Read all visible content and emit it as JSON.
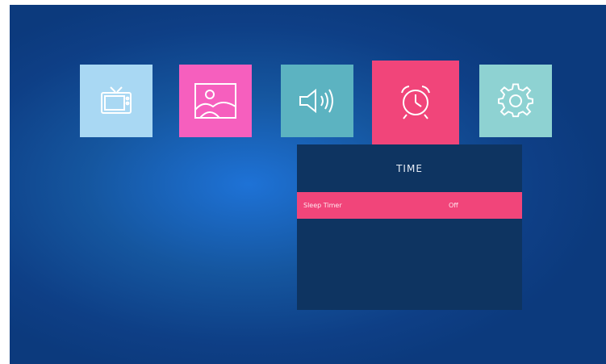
{
  "menu": {
    "tabs": [
      {
        "id": "tv",
        "icon": "tv-icon"
      },
      {
        "id": "picture",
        "icon": "picture-icon"
      },
      {
        "id": "sound",
        "icon": "speaker-icon"
      },
      {
        "id": "time",
        "icon": "alarm-clock-icon",
        "selected": true
      },
      {
        "id": "setup",
        "icon": "gear-icon"
      }
    ]
  },
  "panel": {
    "title": "TIME",
    "rows": [
      {
        "label": "Sleep Timer",
        "value": "Off",
        "highlighted": true
      }
    ]
  },
  "colors": {
    "background": "#0e3f86",
    "panel": "#0e3461",
    "highlight": "#f1457a",
    "tv_tile": "#a9d8f3",
    "picture_tile": "#f65fbe",
    "sound_tile": "#5cb3c1",
    "time_tile": "#f1457a",
    "setup_tile": "#8ed2d2"
  }
}
